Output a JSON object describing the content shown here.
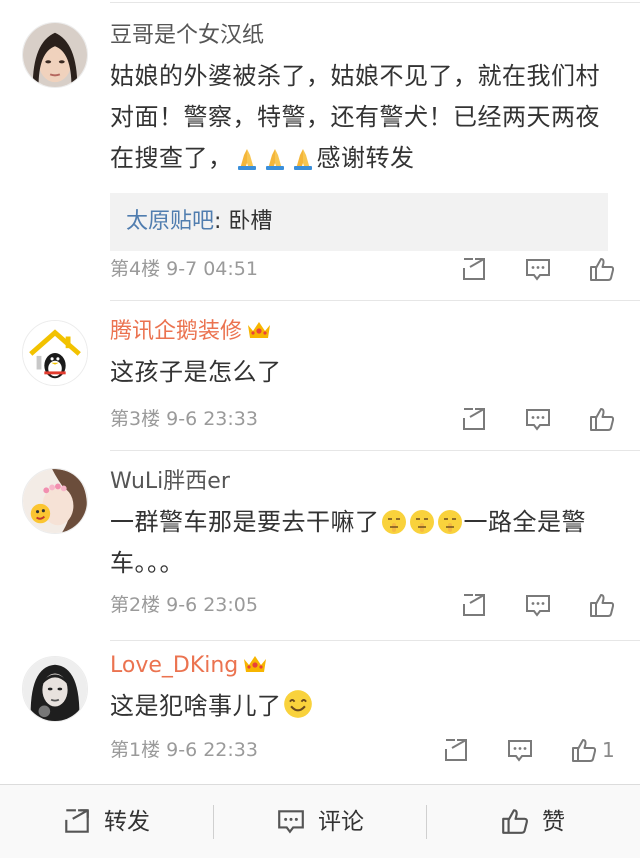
{
  "comments": [
    {
      "username": "豆哥是个女汉纸",
      "text_parts": [
        "姑娘的外婆被杀了，姑娘不见了，就在我们村对面！警察，特警，还有警犬！已经两天两夜在搜查了，",
        "感谢转发"
      ],
      "emoji": "praying-hands",
      "quote_source": "太原贴吧",
      "quote_text": ": 卧槽",
      "floor": "第4楼",
      "time": "9-7 04:51"
    },
    {
      "username": "腾讯企鹅装修",
      "text": "这孩子是怎么了",
      "floor": "第3楼",
      "time": "9-6 23:33"
    },
    {
      "username": "WuLi胖西er",
      "text_parts": [
        "一群警车那是要去干嘛了",
        "一路全是警车。。。"
      ],
      "emoji": "shush-face",
      "floor": "第2楼",
      "time": "9-6 23:05"
    },
    {
      "username": "Love_DKing",
      "text": "这是犯啥事儿了",
      "emoji": "smile-face",
      "floor": "第1楼",
      "time": "9-6 22:33",
      "like_count": "1"
    }
  ],
  "toolbar": {
    "repost_label": "转发",
    "comment_label": "评论",
    "like_label": "赞"
  },
  "colors": {
    "vip_name": "#eb7350",
    "link": "#507daf",
    "meta": "#9a9a9a"
  }
}
